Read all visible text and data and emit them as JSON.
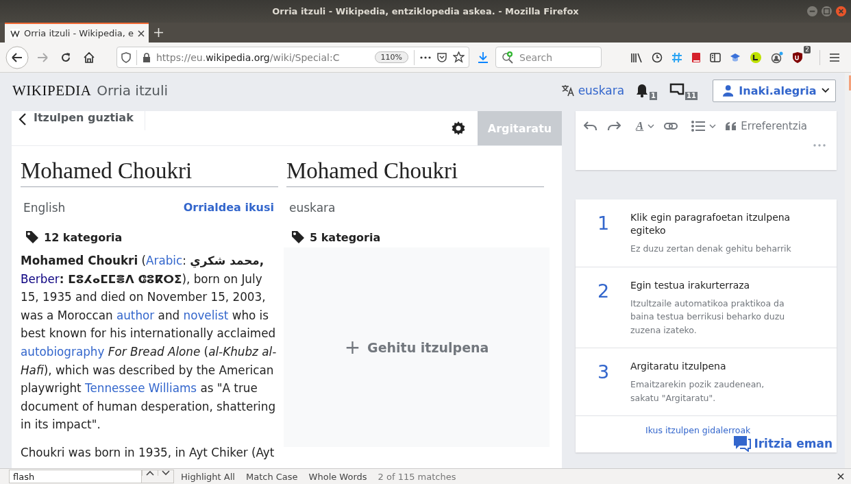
{
  "window": {
    "title": "Orria itzuli - Wikipedia, entziklopedia askea. - Mozilla Firefox"
  },
  "tabs": [
    {
      "label": "Orria itzuli - Wikipedia, e",
      "selected": true
    }
  ],
  "nav_buttons": [
    {
      "kind": "back",
      "disabled": false
    },
    {
      "kind": "forward",
      "disabled": true
    },
    {
      "kind": "reload",
      "disabled": false
    },
    {
      "kind": "home",
      "disabled": false
    }
  ],
  "url_bar": {
    "scheme": "https://eu.",
    "domain": "wikipedia.org",
    "path": "/wiki/Special:C",
    "zoom": "110%"
  },
  "search": {
    "placeholder": "Search"
  },
  "extension_badge": "2",
  "header": {
    "logo": "WIKIPEDIA",
    "title": "Orria itzuli",
    "language": "euskara",
    "alerts_count": "1",
    "notices_count": "11",
    "user": "Inaki.alegria"
  },
  "translation": {
    "back_label": "Itzulpen guztiak",
    "publish": {
      "label": "Argitaratu",
      "disabled": true
    },
    "source": {
      "title": "Mohamed Choukri",
      "language": "English",
      "view_link": "Orrialdea ikusi",
      "categories": "12 kategoria",
      "paragraphs": [
        [
          {
            "kind": "text",
            "text": "**Mohamed Choukri** ("
          },
          {
            "kind": "link",
            "text": "Arabic"
          },
          {
            "kind": "text",
            "text": ": **محمد شكري,** "
          },
          {
            "kind": "visited_link",
            "text": "Berber"
          },
          {
            "kind": "text",
            "text": "**: ⵎⵓⵃⴰⵎⵎⴻⴷ ⵛⵓⴽⵔⵉ**), born on July 15, 1935 and died on November 15, 2003, was a Moroccan "
          },
          {
            "kind": "link",
            "text": "author"
          },
          {
            "kind": "text",
            "text": " and "
          },
          {
            "kind": "link",
            "text": "novelist"
          },
          {
            "kind": "text",
            "text": " who is best known for his internationally acclaimed "
          },
          {
            "kind": "link",
            "text": "autobiography"
          },
          {
            "kind": "text",
            "text": " *For Bread Alone* (*al-Khubz al-Hafi*), which was described by the American playwright "
          },
          {
            "kind": "link",
            "text": "Tennessee Williams"
          },
          {
            "kind": "text",
            "text": " as \"A true document of human desperation, shattering in its impact\"."
          }
        ],
        [
          {
            "kind": "text",
            "text": "Choukri was born in 1935, in Ayt Chiker (Ayt"
          }
        ]
      ]
    },
    "target": {
      "title": "Mohamed Choukri",
      "language": "euskara",
      "categories": "5 kategoria",
      "add_icon": "+",
      "add_label": "Gehitu itzulpena"
    }
  },
  "editor_toolbar": {
    "style_glyph": "A",
    "reference": "Erreferentzia"
  },
  "steps": [
    {
      "number": "1",
      "title": "Klik egin paragrafoetan itzulpena egiteko",
      "description": "Ez duzu zertan denak gehitu beharrik"
    },
    {
      "number": "2",
      "title": "Egin testua irakurterraza",
      "description": "Itzultzaile automatikoa praktikoa da baina testua berrikusi beharko duzu zuzena izateko."
    },
    {
      "number": "3",
      "title": "Argitaratu itzulpena",
      "description": "Emaitzarekin pozik zaudenean, sakatu \"Argitaratu\"."
    }
  ],
  "guidelines_link": "Ikus itzulpen gidalerroak",
  "feedback_button": "Iritzia eman",
  "find_bar": {
    "query": "flash",
    "options": [
      "Highlight All",
      "Match Case",
      "Whole Words"
    ],
    "status": "2 of 115 matches"
  }
}
